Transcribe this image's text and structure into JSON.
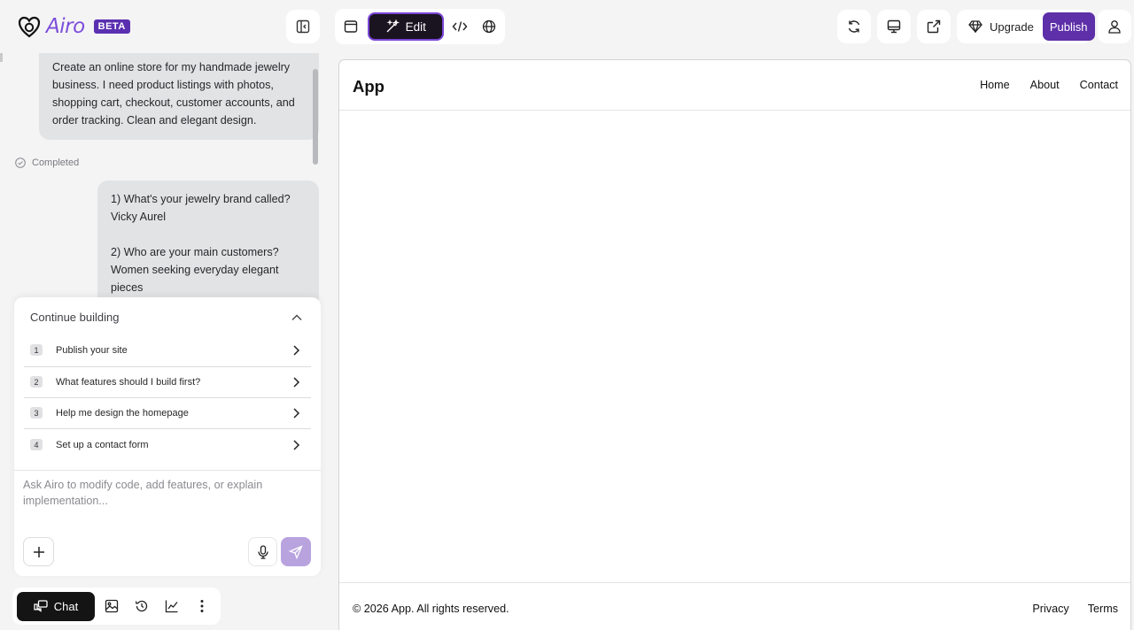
{
  "app": {
    "brand": "Airo",
    "badge": "BETA"
  },
  "toolbar": {
    "edit_label": "Edit",
    "upgrade_label": "Upgrade",
    "publish_label": "Publish"
  },
  "chat": {
    "user_message": "Create an online store for my handmade jewelry business. I need product listings with photos, shopping cart, checkout, customer accounts, and order tracking. Clean and elegant design.",
    "status": "Completed",
    "answers": [
      "1) What's your jewelry brand called?",
      "Vicky Aurel",
      "",
      "2) Who are your main customers?",
      "Women seeking everyday elegant pieces"
    ]
  },
  "continue_panel": {
    "title": "Continue building",
    "suggestions": [
      {
        "num": "1",
        "label": "Publish your site"
      },
      {
        "num": "2",
        "label": "What features should I build first?"
      },
      {
        "num": "3",
        "label": "Help me design the homepage"
      },
      {
        "num": "4",
        "label": "Set up a contact form"
      }
    ],
    "prompt_placeholder": "Ask Airo to modify code, add features, or explain implementation..."
  },
  "bottom_bar": {
    "chat_label": "Chat"
  },
  "preview": {
    "title": "App",
    "nav": [
      "Home",
      "About",
      "Contact"
    ],
    "copyright": "© 2026 App. All rights reserved.",
    "footer_links": [
      "Privacy",
      "Terms"
    ]
  },
  "colors": {
    "accent": "#5d2fa8",
    "brand": "#7c4ddb",
    "send_disabled": "#b8a3de"
  }
}
